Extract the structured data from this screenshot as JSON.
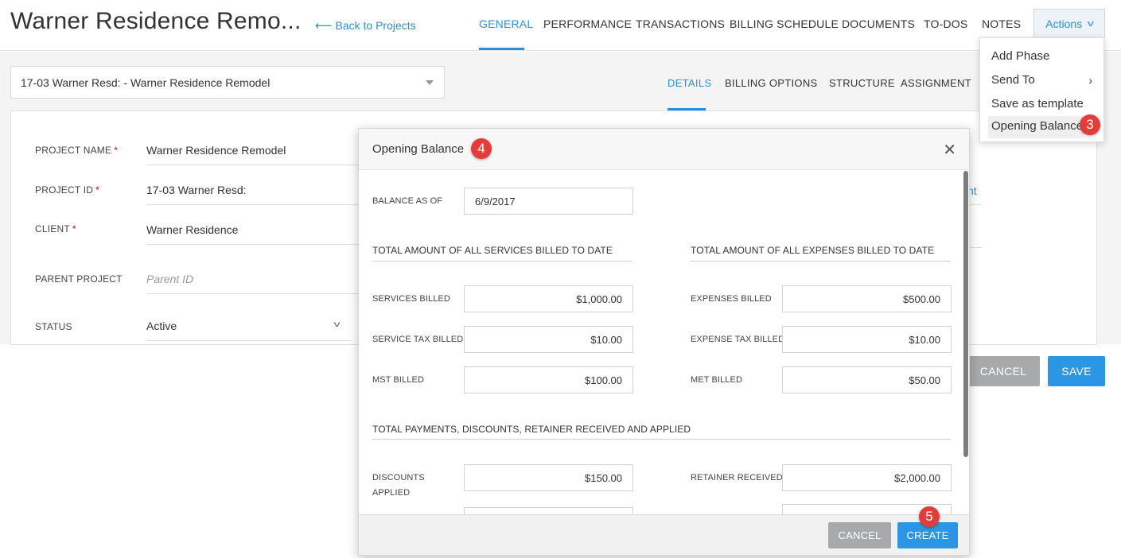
{
  "header": {
    "title": "Warner Residence Remo...",
    "back_link": "Back to Projects",
    "back_arrow": "⟵",
    "tabs": [
      "GENERAL",
      "PERFORMANCE",
      "TRANSACTIONS",
      "BILLING SCHEDULE",
      "DOCUMENTS",
      "TO-DOS",
      "NOTES"
    ],
    "active_tab": "GENERAL",
    "actions_label": "Actions",
    "actions_chevron": "v"
  },
  "actions_menu": {
    "items": [
      "Add Phase",
      "Send To",
      "Save as template",
      "Opening Balance"
    ],
    "send_to_chevron": "›",
    "highlighted": "Opening Balance"
  },
  "project_selector": {
    "value": "17-03 Warner Resd: - Warner Residence Remodel"
  },
  "subtabs": {
    "items": [
      "DETAILS",
      "BILLING OPTIONS",
      "STRUCTURE",
      "ASSIGNMENT"
    ],
    "active": "DETAILS"
  },
  "form": {
    "project_name_label": "PROJECT NAME",
    "project_name_value": "Warner Residence Remodel",
    "project_id_label": "PROJECT ID",
    "project_id_value": "17-03 Warner Resd:",
    "client_label": "CLIENT",
    "client_value": "Warner Residence",
    "parent_project_label": "PARENT PROJECT",
    "parent_project_placeholder": "Parent ID",
    "status_label": "STATUS",
    "status_value": "Active",
    "required_marker": "*",
    "right_link_fragment": "nt",
    "status_caret": "v"
  },
  "page_buttons": {
    "cancel": "CANCEL",
    "save": "SAVE"
  },
  "badges": {
    "actions_menu": "3",
    "modal_title": "4",
    "create": "5"
  },
  "modal": {
    "title": "Opening Balance",
    "close": "✕",
    "balance_as_of_label": "BALANCE AS OF",
    "balance_as_of_value": "6/9/2017",
    "services_section": "TOTAL AMOUNT OF ALL SERVICES BILLED TO DATE",
    "expenses_section": "TOTAL AMOUNT OF ALL EXPENSES BILLED TO DATE",
    "payments_section": "TOTAL PAYMENTS, DISCOUNTS, RETAINER RECEIVED AND APPLIED",
    "services_billed_label": "SERVICES BILLED",
    "services_billed_value": "$1,000.00",
    "service_tax_billed_label": "SERVICE TAX BILLED",
    "service_tax_billed_value": "$10.00",
    "mst_billed_label": "MST BILLED",
    "mst_billed_value": "$100.00",
    "expenses_billed_label": "EXPENSES BILLED",
    "expenses_billed_value": "$500.00",
    "expense_tax_billed_label": "EXPENSE TAX BILLED",
    "expense_tax_billed_value": "$10.00",
    "met_billed_label": "MET BILLED",
    "met_billed_value": "$50.00",
    "discounts_applied_label_1": "DISCOUNTS",
    "discounts_applied_label_2": "APPLIED",
    "discounts_applied_value": "$150.00",
    "retainer_received_label": "RETAINER RECEIVED",
    "retainer_received_value": "$2,000.00",
    "cancel": "CANCEL",
    "create": "CREATE"
  },
  "colors": {
    "accent": "#2b8fd6",
    "badge": "#e43b3b",
    "gray_button": "#a7a9ab",
    "primary_button": "#2b96e3"
  }
}
